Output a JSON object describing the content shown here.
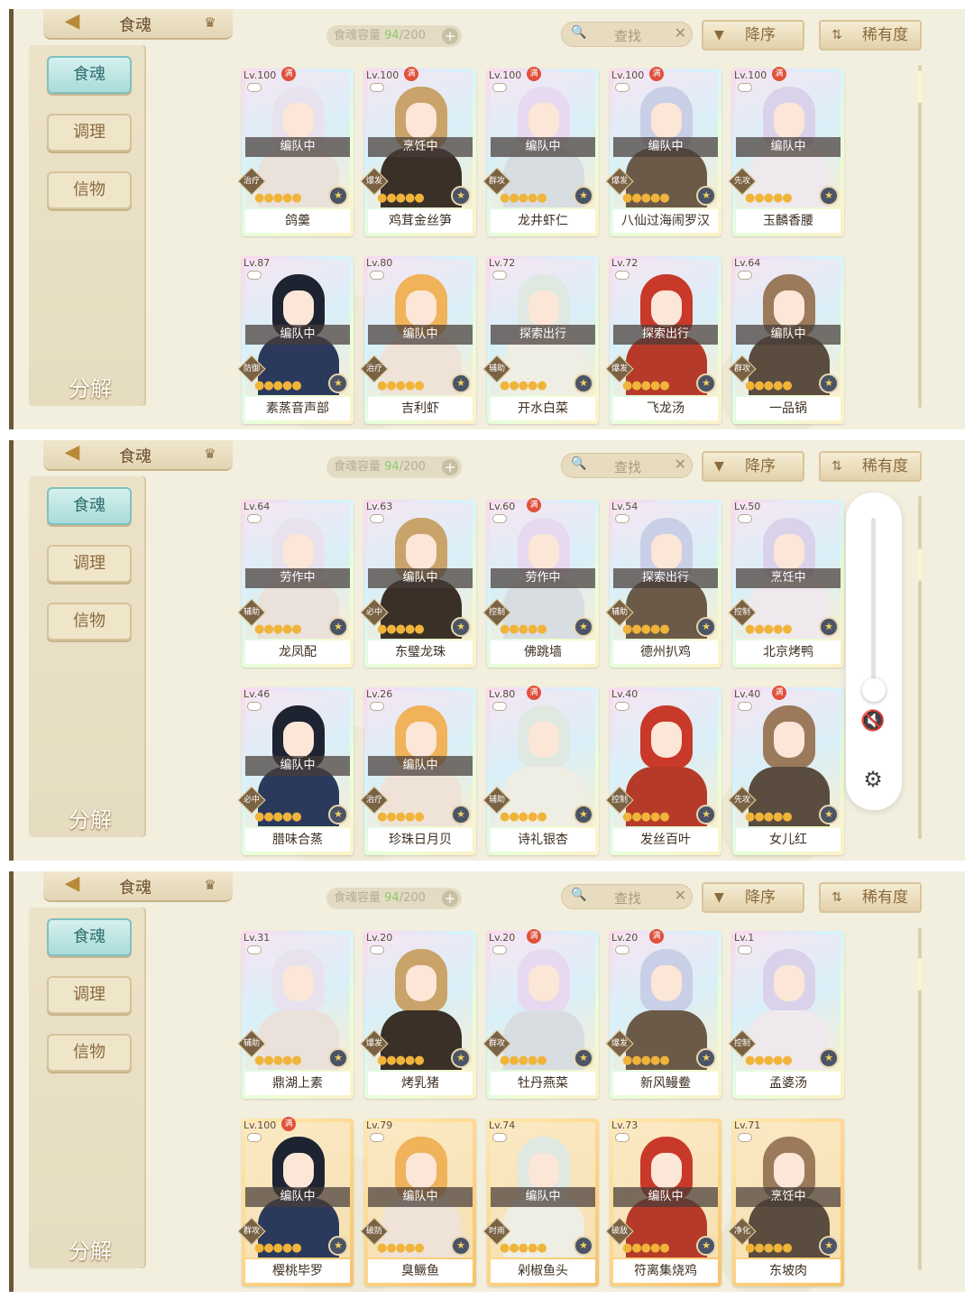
{
  "header": {
    "title": "食魂",
    "capacity_current": "94",
    "capacity_total": "/200",
    "capacity_label": "食魂容量 ",
    "search_placeholder": "查找",
    "sort_order": "降序",
    "sort_by": "稀有度"
  },
  "sidebar": {
    "items": [
      {
        "label": "食魂"
      },
      {
        "label": "调理"
      },
      {
        "label": "信物"
      }
    ],
    "decompose": "分解"
  },
  "panels": [
    {
      "cards": [
        {
          "level": "Lv.100",
          "full": "满",
          "status": "编队中",
          "role": "治疗",
          "name": "鸽羹"
        },
        {
          "level": "Lv.100",
          "full": "满",
          "status": "烹饪中",
          "role": "爆发",
          "name": "鸡茸金丝笋"
        },
        {
          "level": "Lv.100",
          "full": "满",
          "status": "编队中",
          "role": "群攻",
          "name": "龙井虾仁"
        },
        {
          "level": "Lv.100",
          "full": "满",
          "status": "编队中",
          "role": "爆发",
          "name": "八仙过海闹罗汉"
        },
        {
          "level": "Lv.100",
          "full": "满",
          "status": "编队中",
          "role": "先攻",
          "name": "玉麟香腰"
        },
        {
          "level": "Lv.87",
          "full": "",
          "status": "编队中",
          "role": "防御",
          "name": "素蒸音声部"
        },
        {
          "level": "Lv.80",
          "full": "",
          "status": "编队中",
          "role": "治疗",
          "name": "吉利虾"
        },
        {
          "level": "Lv.72",
          "full": "",
          "status": "探索出行",
          "role": "辅助",
          "name": "开水白菜"
        },
        {
          "level": "Lv.72",
          "full": "",
          "status": "探索出行",
          "role": "爆发",
          "name": "飞龙汤"
        },
        {
          "level": "Lv.64",
          "full": "",
          "status": "编队中",
          "role": "群攻",
          "name": "一品锅"
        }
      ]
    },
    {
      "cards": [
        {
          "level": "Lv.64",
          "full": "",
          "status": "劳作中",
          "role": "辅助",
          "name": "龙凤配"
        },
        {
          "level": "Lv.63",
          "full": "",
          "status": "编队中",
          "role": "必中",
          "name": "东璧龙珠"
        },
        {
          "level": "Lv.60",
          "full": "满",
          "status": "劳作中",
          "role": "控制",
          "name": "佛跳墙"
        },
        {
          "level": "Lv.54",
          "full": "",
          "status": "探索出行",
          "role": "辅助",
          "name": "德州扒鸡"
        },
        {
          "level": "Lv.50",
          "full": "",
          "status": "烹饪中",
          "role": "控制",
          "name": "北京烤鸭"
        },
        {
          "level": "Lv.46",
          "full": "",
          "status": "编队中",
          "role": "必中",
          "name": "腊味合蒸"
        },
        {
          "level": "Lv.26",
          "full": "",
          "status": "编队中",
          "role": "治疗",
          "name": "珍珠日月贝"
        },
        {
          "level": "Lv.80",
          "full": "满",
          "status": "",
          "role": "辅助",
          "name": "诗礼银杏"
        },
        {
          "level": "Lv.40",
          "full": "",
          "status": "",
          "role": "控制",
          "name": "发丝百叶"
        },
        {
          "level": "Lv.40",
          "full": "满",
          "status": "",
          "role": "先攻",
          "name": "女儿红"
        }
      ]
    },
    {
      "cards": [
        {
          "level": "Lv.31",
          "full": "",
          "status": "",
          "role": "辅助",
          "name": "鼎湖上素"
        },
        {
          "level": "Lv.20",
          "full": "",
          "status": "",
          "role": "爆发",
          "name": "烤乳猪"
        },
        {
          "level": "Lv.20",
          "full": "满",
          "status": "",
          "role": "群攻",
          "name": "牡丹燕菜"
        },
        {
          "level": "Lv.20",
          "full": "满",
          "status": "",
          "role": "爆发",
          "name": "新风鳗鲞"
        },
        {
          "level": "Lv.1",
          "full": "",
          "status": "",
          "role": "控制",
          "name": "孟婆汤"
        },
        {
          "level": "Lv.100",
          "full": "满",
          "status": "编队中",
          "role": "群攻",
          "name": "樱桃毕罗"
        },
        {
          "level": "Lv.79",
          "full": "",
          "status": "编队中",
          "role": "破防",
          "name": "臭鳜鱼"
        },
        {
          "level": "Lv.74",
          "full": "",
          "status": "编队中",
          "role": "时雨",
          "name": "剁椒鱼头"
        },
        {
          "level": "Lv.73",
          "full": "",
          "status": "编队中",
          "role": "破敌",
          "name": "符离集烧鸡"
        },
        {
          "level": "Lv.71",
          "full": "",
          "status": "烹饪中",
          "role": "净化",
          "name": "东坡肉"
        }
      ]
    }
  ],
  "volume": {
    "muted": true,
    "icon_mute": "mute-icon",
    "icon_settings": "gear-icon"
  }
}
